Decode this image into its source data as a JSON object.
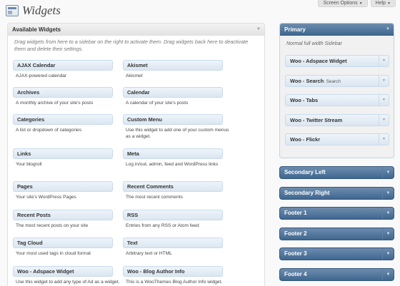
{
  "screen_meta": {
    "screen_options": "Screen Options",
    "help": "Help"
  },
  "page": {
    "title": "Widgets"
  },
  "available": {
    "title": "Available Widgets",
    "description": "Drag widgets from here to a sidebar on the right to activate them. Drag widgets back here to deactivate them and delete their settings.",
    "left": [
      {
        "name": "AJAX Calendar",
        "desc": "AJAX-powered calendar"
      },
      {
        "name": "Archives",
        "desc": "A monthly archive of your site's posts"
      },
      {
        "name": "Categories",
        "desc": "A list or dropdown of categories"
      },
      {
        "name": "Links",
        "desc": "Your blogroll"
      },
      {
        "name": "Pages",
        "desc": "Your site's WordPress Pages"
      },
      {
        "name": "Recent Posts",
        "desc": "The most recent posts on your site"
      },
      {
        "name": "Tag Cloud",
        "desc": "Your most used tags in cloud format"
      },
      {
        "name": "Woo - Adspace Widget",
        "desc": "Use this widget to add any type of Ad as a widget."
      }
    ],
    "right": [
      {
        "name": "Akismet",
        "desc": "Akismet"
      },
      {
        "name": "Calendar",
        "desc": "A calendar of your site's posts"
      },
      {
        "name": "Custom Menu",
        "desc": "Use this widget to add one of your custom menus as a widget."
      },
      {
        "name": "Meta",
        "desc": "Log in/out, admin, feed and WordPress links"
      },
      {
        "name": "Recent Comments",
        "desc": "The most recent comments"
      },
      {
        "name": "RSS",
        "desc": "Entries from any RSS or Atom feed"
      },
      {
        "name": "Text",
        "desc": "Arbitrary text or HTML"
      },
      {
        "name": "Woo - Blog Author Info",
        "desc": "This is a WooThemes Blog Author Info widget."
      }
    ]
  },
  "primary": {
    "title": "Primary",
    "description": "Normal full width Sidebar",
    "widgets": [
      {
        "name": "Woo - Adspace Widget",
        "sub": ""
      },
      {
        "name": "Woo - Search",
        "sub": ": Search"
      },
      {
        "name": "Woo - Tabs",
        "sub": ""
      },
      {
        "name": "Woo - Twitter Stream",
        "sub": ""
      },
      {
        "name": "Woo - Flickr",
        "sub": ""
      }
    ]
  },
  "sidebars": [
    "Secondary Left",
    "Secondary Right",
    "Footer 1",
    "Footer 2",
    "Footer 3",
    "Footer 4"
  ]
}
